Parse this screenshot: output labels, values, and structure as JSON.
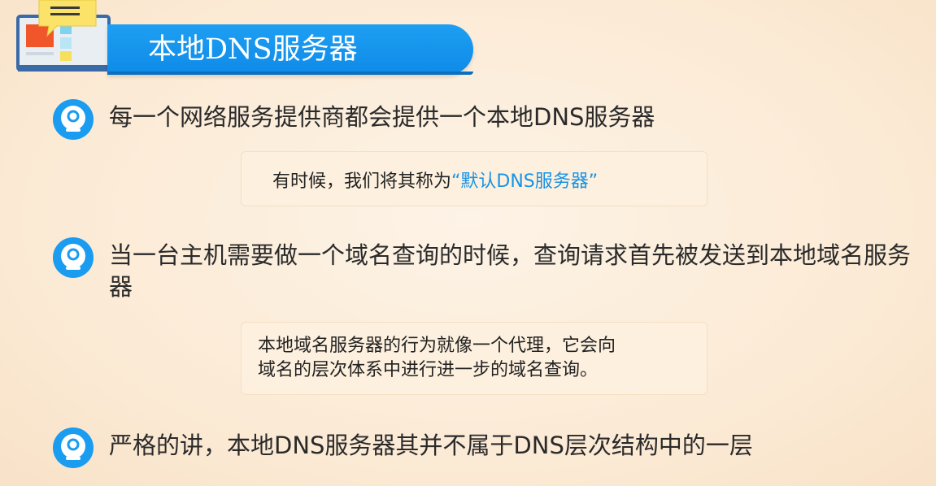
{
  "header": {
    "title": "本地DNS服务器"
  },
  "bullets": [
    {
      "text": "每一个网络服务提供商都会提供一个本地DNS服务器"
    },
    {
      "text": "当一台主机需要做一个域名查询的时候，查询请求首先被发送到本地域名服务器"
    },
    {
      "text": "严格的讲，本地DNS服务器其并不属于DNS层次结构中的一层"
    }
  ],
  "notes": {
    "note1_prefix": "有时候，我们将其称为",
    "note1_highlight": "“默认DNS服务器”",
    "note2_line1": "本地域名服务器的行为就像一个代理，它会向",
    "note2_line2": "域名的层次体系中进行进一步的域名查询。"
  },
  "colors": {
    "banner": "#0e8ae8",
    "highlight": "#1893e6",
    "bullet_icon": "#1a9cf0"
  },
  "icons": {
    "logo": "monitor-chat-icon",
    "bullet": "webcam-bullet-icon"
  }
}
